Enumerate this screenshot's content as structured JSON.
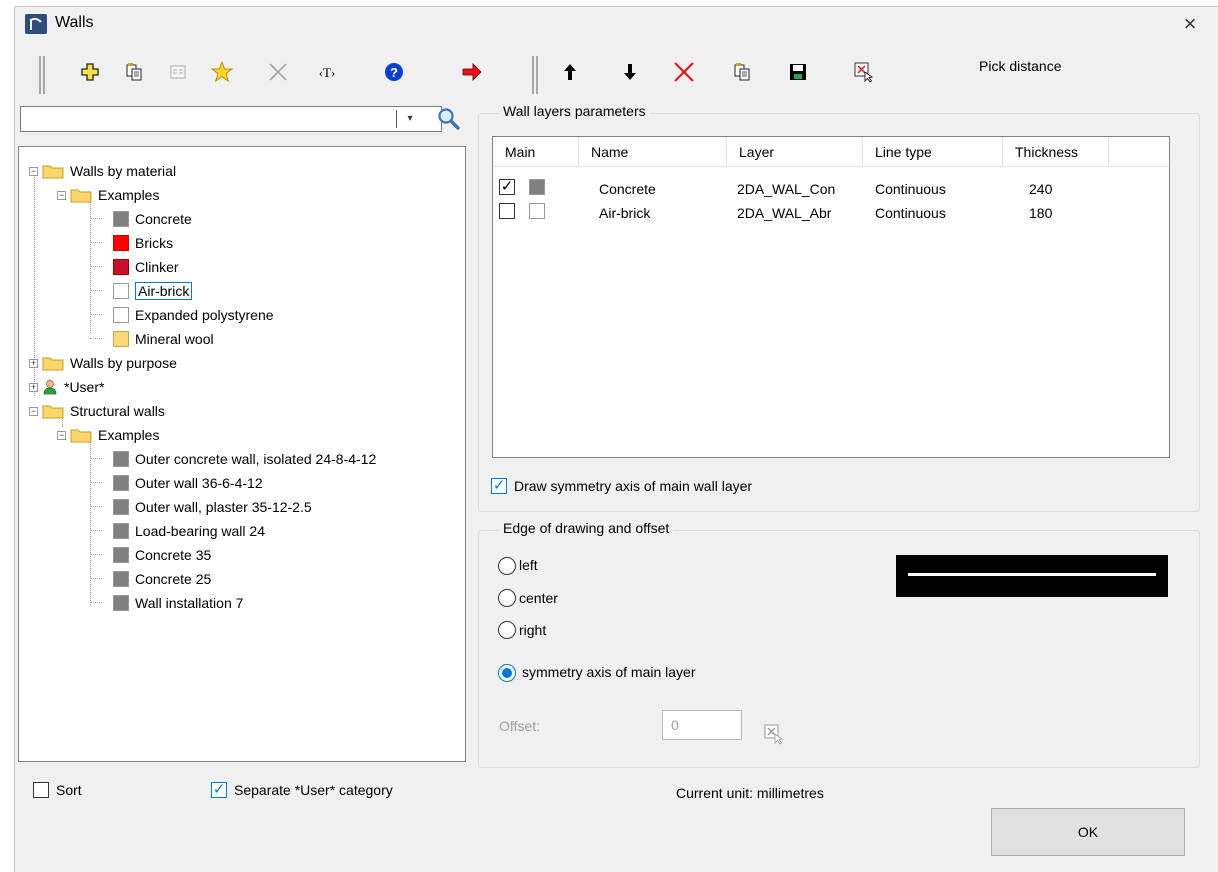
{
  "window": {
    "title": "Walls",
    "close_symbol": "×"
  },
  "toolbar_left": [
    {
      "name": "add-icon"
    },
    {
      "name": "copy-icon"
    },
    {
      "name": "properties-icon"
    },
    {
      "name": "favorite-star-icon"
    },
    {
      "name": "delete-x-icon"
    },
    {
      "name": "rename-text-icon"
    },
    {
      "name": "help-icon"
    },
    {
      "name": "transfer-arrow-icon"
    }
  ],
  "toolbar_right": [
    {
      "name": "move-up-icon"
    },
    {
      "name": "move-down-icon"
    },
    {
      "name": "delete-layer-icon"
    },
    {
      "name": "copy-layer-icon"
    },
    {
      "name": "save-icon"
    },
    {
      "name": "pick-icon"
    }
  ],
  "pick_distance_label": "Pick distance",
  "search": {
    "value": "",
    "dropdown_symbol": "▾"
  },
  "tree": {
    "nodes": [
      {
        "label": "Walls by material",
        "expander": "−"
      },
      {
        "label": "Examples",
        "expander": "−"
      },
      {
        "label": "Concrete",
        "color": "#808080"
      },
      {
        "label": "Bricks",
        "color": "#ff0000"
      },
      {
        "label": "Clinker",
        "color": "#c8102e"
      },
      {
        "label": "Air-brick",
        "color": "#ffffff"
      },
      {
        "label": "Expanded polystyrene",
        "color": "#ffffff"
      },
      {
        "label": "Mineral wool",
        "color": "#fcd77a"
      },
      {
        "label": "Walls by purpose",
        "expander": "+"
      },
      {
        "label": "*User*",
        "expander": "+"
      },
      {
        "label": "Structural walls",
        "expander": "−"
      },
      {
        "label": "Examples",
        "expander": "−"
      },
      {
        "label": "Outer concrete wall, isolated 24-8-4-12",
        "color": "#808080"
      },
      {
        "label": "Outer wall 36-6-4-12",
        "color": "#808080"
      },
      {
        "label": "Outer wall, plaster 35-12-2.5",
        "color": "#808080"
      },
      {
        "label": "Load-bearing wall 24",
        "color": "#808080"
      },
      {
        "label": "Concrete 35",
        "color": "#808080"
      },
      {
        "label": "Concrete 25",
        "color": "#808080"
      },
      {
        "label": "Wall installation 7",
        "color": "#808080"
      }
    ]
  },
  "sort_label": "Sort",
  "separate_user_label": "Separate *User* category",
  "layers": {
    "group_title": "Wall layers parameters",
    "columns": [
      "Main",
      "Name",
      "Layer",
      "Line type",
      "Thickness"
    ],
    "rows": [
      {
        "main": true,
        "swatch": "#808080",
        "name": "Concrete",
        "layer": "2DA_WAL_Con",
        "line_type": "Continuous",
        "thickness": "240"
      },
      {
        "main": false,
        "swatch": "#ffffff",
        "name": "Air-brick",
        "layer": "2DA_WAL_Abr",
        "line_type": "Continuous",
        "thickness": "180"
      }
    ],
    "draw_symmetry_label": "Draw symmetry axis of main wall layer"
  },
  "edge": {
    "group_title": "Edge of drawing and offset",
    "options": [
      "left",
      "center",
      "right",
      "symmetry axis of main layer"
    ],
    "selected": "symmetry axis of main layer",
    "offset_label": "Offset:",
    "offset_value": "0"
  },
  "current_unit": "Current unit: millimetres",
  "ok_label": "OK",
  "check_symbol": "✓"
}
